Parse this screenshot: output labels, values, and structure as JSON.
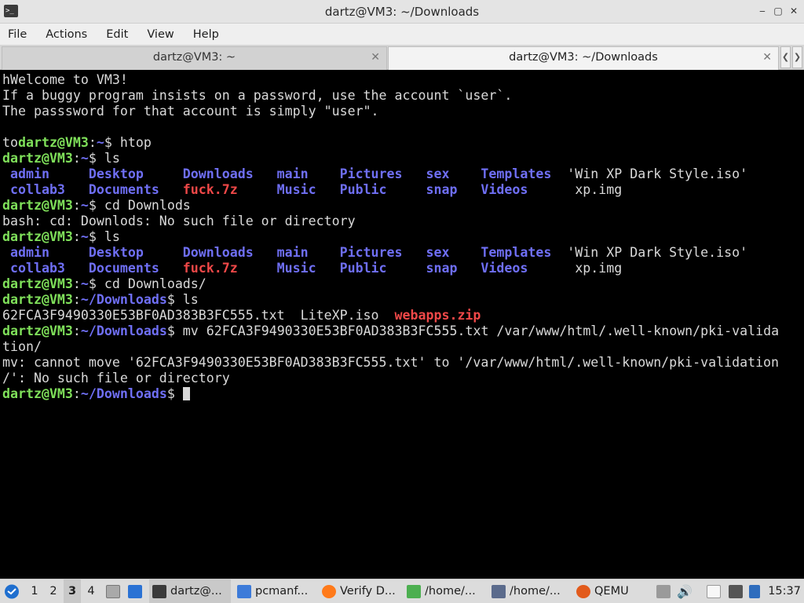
{
  "window": {
    "title": "dartz@VM3: ~/Downloads",
    "app_icon_text": ">_"
  },
  "menu": [
    "File",
    "Actions",
    "Edit",
    "View",
    "Help"
  ],
  "tabs": [
    {
      "label": "dartz@VM3: ~",
      "active": false
    },
    {
      "label": "dartz@VM3: ~/Downloads",
      "active": true
    }
  ],
  "terminal": {
    "lines": [
      [
        [
          "hWelcome to VM3!",
          "plain"
        ]
      ],
      [
        [
          "If a buggy program insists on a password, use the account `user`.",
          "plain"
        ]
      ],
      [
        [
          "The passsword for that account is simply \"user\".",
          "plain"
        ]
      ],
      [],
      [
        [
          "to",
          "plain"
        ],
        [
          "dartz@VM3",
          "pu"
        ],
        [
          ":",
          "plain"
        ],
        [
          "~",
          "pp"
        ],
        [
          "$ htop",
          "plain"
        ]
      ],
      [
        [
          "dartz@VM3",
          "pu"
        ],
        [
          ":",
          "plain"
        ],
        [
          "~",
          "pp"
        ],
        [
          "$ ls",
          "plain"
        ]
      ],
      [
        [
          " admin     Desktop     Downloads   main    Pictures   sex    Templates ",
          "dir"
        ],
        [
          " 'Win XP Dark Style.iso'",
          "plain"
        ]
      ],
      [
        [
          " collab3   Documents   ",
          "dir"
        ],
        [
          "fuck.7z",
          "arc"
        ],
        [
          "     ",
          "plain"
        ],
        [
          "Music   Public     snap   Videos",
          "dir"
        ],
        [
          "      xp.img",
          "plain"
        ]
      ],
      [
        [
          "dartz@VM3",
          "pu"
        ],
        [
          ":",
          "plain"
        ],
        [
          "~",
          "pp"
        ],
        [
          "$ cd Downlods",
          "plain"
        ]
      ],
      [
        [
          "bash: cd: Downlods: No such file or directory",
          "plain"
        ]
      ],
      [
        [
          "dartz@VM3",
          "pu"
        ],
        [
          ":",
          "plain"
        ],
        [
          "~",
          "pp"
        ],
        [
          "$ ls",
          "plain"
        ]
      ],
      [
        [
          " admin     Desktop     Downloads   main    Pictures   sex    Templates ",
          "dir"
        ],
        [
          " 'Win XP Dark Style.iso'",
          "plain"
        ]
      ],
      [
        [
          " collab3   Documents   ",
          "dir"
        ],
        [
          "fuck.7z",
          "arc"
        ],
        [
          "     ",
          "plain"
        ],
        [
          "Music   Public     snap   Videos",
          "dir"
        ],
        [
          "      xp.img",
          "plain"
        ]
      ],
      [
        [
          "dartz@VM3",
          "pu"
        ],
        [
          ":",
          "plain"
        ],
        [
          "~",
          "pp"
        ],
        [
          "$ cd Downloads/",
          "plain"
        ]
      ],
      [
        [
          "dartz@VM3",
          "pu"
        ],
        [
          ":",
          "plain"
        ],
        [
          "~/Downloads",
          "pp"
        ],
        [
          "$ ls",
          "plain"
        ]
      ],
      [
        [
          "62FCA3F9490330E53BF0AD383B3FC555.txt  LiteXP.iso  ",
          "plain"
        ],
        [
          "webapps.zip",
          "arc"
        ]
      ],
      [
        [
          "dartz@VM3",
          "pu"
        ],
        [
          ":",
          "plain"
        ],
        [
          "~/Downloads",
          "pp"
        ],
        [
          "$ mv 62FCA3F9490330E53BF0AD383B3FC555.txt /var/www/html/.well-known/pki-valida",
          "plain"
        ]
      ],
      [
        [
          "tion/",
          "plain"
        ]
      ],
      [
        [
          "mv: cannot move '62FCA3F9490330E53BF0AD383B3FC555.txt' to '/var/www/html/.well-known/pki-validation",
          "plain"
        ]
      ],
      [
        [
          "/': No such file or directory",
          "plain"
        ]
      ],
      [
        [
          "dartz@VM3",
          "pu"
        ],
        [
          ":",
          "plain"
        ],
        [
          "~/Downloads",
          "pp"
        ],
        [
          "$ ",
          "plain"
        ]
      ]
    ]
  },
  "taskbar": {
    "workspaces": [
      "1",
      "2",
      "3",
      "4"
    ],
    "active_workspace": "3",
    "tasks": [
      {
        "label": "dartz@...",
        "icon": "terminal-icon",
        "color": "#3a3a3a"
      },
      {
        "label": "pcmanf...",
        "icon": "folder-icon",
        "color": "#3d7bd9"
      },
      {
        "label": "Verify D...",
        "icon": "firefox-icon",
        "color": "#ff7a1a"
      },
      {
        "label": "/home/...",
        "icon": "text-editor-icon",
        "color": "#4caf50"
      },
      {
        "label": "/home/...",
        "icon": "image-viewer-icon",
        "color": "#5b6b8c"
      },
      {
        "label": "QEMU",
        "icon": "qemu-icon",
        "color": "#e25b1c"
      }
    ],
    "clock": "15:37"
  }
}
